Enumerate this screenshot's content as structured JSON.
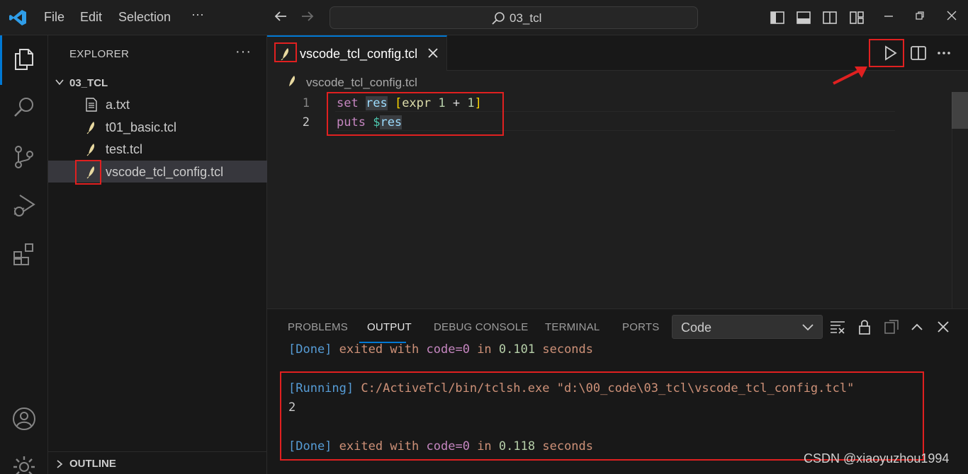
{
  "titlebar": {
    "menu": [
      "File",
      "Edit",
      "Selection",
      "···"
    ],
    "search_text": "03_tcl",
    "icons": [
      "vscode-logo",
      "back-arrow",
      "forward-arrow",
      "search-icon",
      "toggle-sidebar",
      "toggle-panel",
      "toggle-secondary-sidebar",
      "customize-layout",
      "minimize",
      "restore",
      "close"
    ]
  },
  "activitybar": {
    "items": [
      "explorer",
      "search",
      "source-control",
      "run-and-debug",
      "extensions",
      "accounts",
      "manage"
    ]
  },
  "sidebar": {
    "title": "EXPLORER",
    "more": "···",
    "folder": "03_TCL",
    "files": [
      "a.txt",
      "t01_basic.tcl",
      "test.tcl",
      "vscode_tcl_config.tcl"
    ],
    "outline": "OUTLINE"
  },
  "editor": {
    "tab_label": "vscode_tcl_config.tcl",
    "breadcrumb": "vscode_tcl_config.tcl",
    "line_numbers": [
      "1",
      "2"
    ],
    "code": {
      "l1": {
        "kw": "set",
        "var": "res",
        "open": "[",
        "fn": "expr",
        "n1": "1",
        "op": "+",
        "n2": "1",
        "close": "]"
      },
      "l2": {
        "kw": "puts",
        "dollar": "$",
        "var": "res"
      }
    }
  },
  "panel": {
    "tabs": [
      "PROBLEMS",
      "OUTPUT",
      "DEBUG CONSOLE",
      "TERMINAL",
      "PORTS"
    ],
    "active_tab": "OUTPUT",
    "channel": "Code",
    "output": {
      "done1": {
        "tag": "[Done]",
        "text1": "exited with",
        "kw": "code=0",
        "text2": "in",
        "num": "0.101",
        "text3": "seconds"
      },
      "running": {
        "tag": "[Running]",
        "text": "C:/ActiveTcl/bin/tclsh.exe \"d:\\00_code\\03_tcl\\vscode_tcl_config.tcl\""
      },
      "result": "2",
      "done2": {
        "tag": "[Done]",
        "text1": "exited with",
        "kw": "code=0",
        "text2": "in",
        "num": "0.118",
        "text3": "seconds"
      }
    }
  },
  "watermark": "CSDN @xiaoyuzhou1994",
  "colors": {
    "accent": "#0078d4",
    "annotation": "#e02020"
  }
}
